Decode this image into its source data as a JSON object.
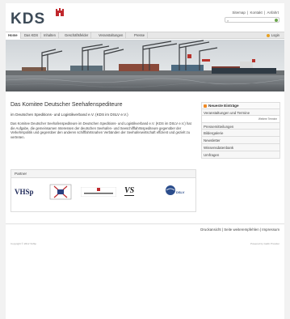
{
  "header": {
    "logo_text": "KDS",
    "top_links": [
      "Sitemap",
      "Kontakt",
      "Anfahrt"
    ],
    "search_placeholder": ""
  },
  "nav": {
    "items": [
      "Home",
      "Das KDS",
      "Inhalten",
      "Geschäftsfelder",
      "Veranstaltungen",
      "Presse"
    ],
    "login_label": "Login"
  },
  "main": {
    "title": "Das Komitee Deutscher Seehafenspediteure",
    "subtitle": "im Deutschen Speditions- und Logistikverband e.V. (KDS im DSLV e.V.)",
    "body": "Das Komitee Deutscher Seehafenspediteure im Deutschen Speditions- und Logistikverband e.V. (KDS im DSLV e.V.) hat die Aufgabe, die gemeinsamen Interessen der deutschen Seehafen- und Seeschifffahrtsspediteure gegenüber der Verkehrspolitik und gegenüber den anderen schifffahrtsnahen Verbänden der Seehafenwirtschaft effizient und gezielt zu vertreten."
  },
  "partners": {
    "heading": "Partner",
    "logos": [
      "VHSp",
      "",
      "",
      "VS",
      "DSLV"
    ]
  },
  "sidebar": {
    "news_heading": "Neueste Einträge",
    "first_item": "Veranstaltungen und Termine",
    "more_link": "Weitere Termine",
    "items": [
      "Pressemitteilungen",
      "Bildergalerie",
      "Newsletter",
      "Wissensdatenbank",
      "Umfragen"
    ]
  },
  "footer": {
    "links": [
      "Druckansicht",
      "Seite weiterempfehlen",
      "Impressum"
    ],
    "copyright": "Copyright © 2012 VHSp",
    "powered": "Powered by Gabb Provider"
  },
  "colors": {
    "brand_red": "#c0282d",
    "logo_gray": "#3d4b58",
    "rss_orange": "#f08a24"
  }
}
